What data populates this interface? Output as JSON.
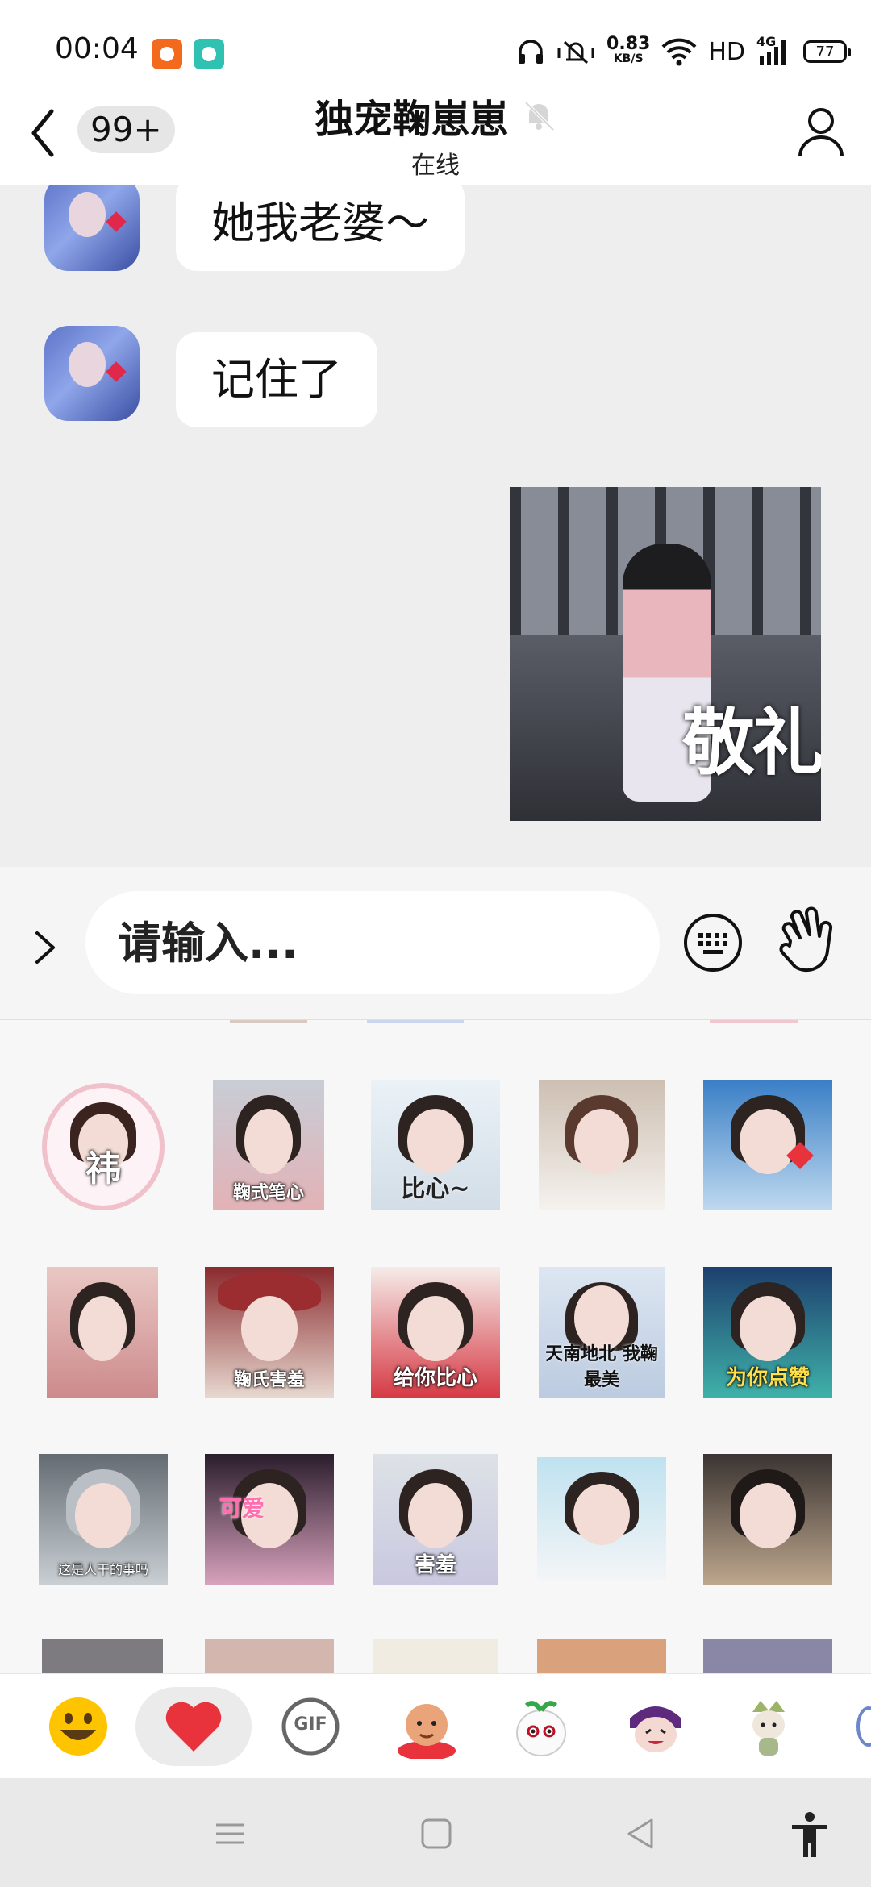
{
  "status_bar": {
    "time": "00:04",
    "net_speed_value": "0.83",
    "net_speed_unit": "KB/S",
    "hd_label": "HD",
    "network_type": "4G",
    "battery_level": "77"
  },
  "header": {
    "badge_count": "99+",
    "title": "独宠鞠崽崽",
    "status": "在线"
  },
  "messages": [
    {
      "sender": "other",
      "type": "text",
      "text": "她我老婆～"
    },
    {
      "sender": "other",
      "type": "text",
      "text": "记住了"
    },
    {
      "sender": "self",
      "type": "sticker",
      "caption": "敬礼"
    }
  ],
  "input": {
    "placeholder": "请输入..."
  },
  "sticker_panel": {
    "stickers": [
      {
        "caption": "祎"
      },
      {
        "caption": "鞠式笔心"
      },
      {
        "caption": "比心~"
      },
      {
        "caption": ""
      },
      {
        "caption": ""
      },
      {
        "caption": ""
      },
      {
        "caption": "鞠氏害羞"
      },
      {
        "caption": "给你比心"
      },
      {
        "caption": "天南地北 我鞠最美"
      },
      {
        "caption": "为你点赞"
      },
      {
        "caption": "这是人干的事吗"
      },
      {
        "caption": "可爱"
      },
      {
        "caption": "害羞"
      },
      {
        "caption": ""
      },
      {
        "caption": ""
      }
    ]
  },
  "emoji_tabs": [
    {
      "icon": "smiley-face-icon",
      "active": false
    },
    {
      "icon": "heart-icon",
      "active": true
    },
    {
      "icon": "gif-icon",
      "label": "GIF",
      "active": false
    },
    {
      "icon": "baby-sticker-icon",
      "active": false
    },
    {
      "icon": "radish-sticker-icon",
      "active": false
    },
    {
      "icon": "purple-character-sticker-icon",
      "active": false
    },
    {
      "icon": "fairy-sticker-icon",
      "active": false
    }
  ],
  "colors": {
    "chat_background": "#eeeeee",
    "bubble_background": "#ffffff",
    "heart_red": "#e8323c",
    "smiley_yellow": "#ffc400"
  }
}
